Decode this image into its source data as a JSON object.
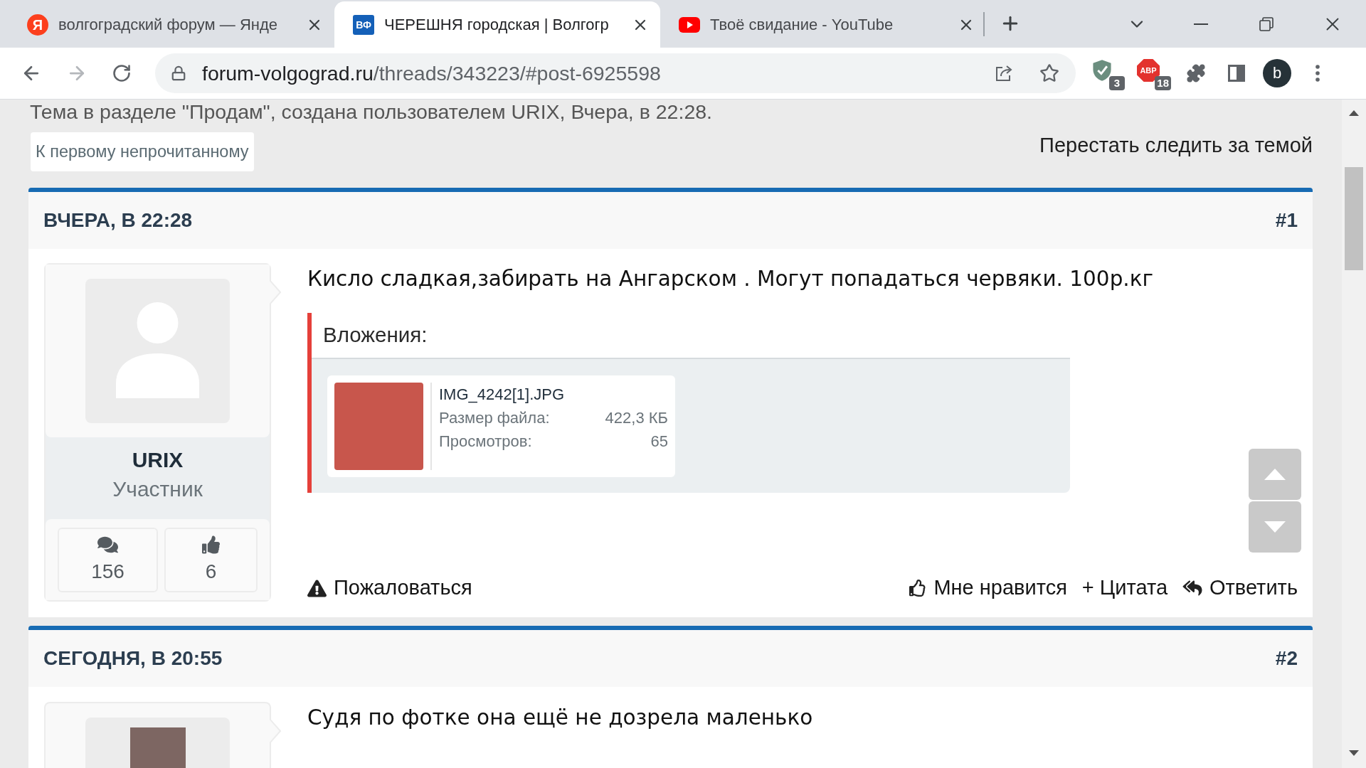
{
  "browser": {
    "tabs": [
      {
        "kind": "letter-circle",
        "favicon": "Я",
        "title": "волгоградский форум — Янде",
        "selected": false
      },
      {
        "kind": "letter-square",
        "favicon": "ВФ",
        "title": "ЧЕРЕШНЯ городская | Волгогр",
        "selected": true
      },
      {
        "kind": "play",
        "title": "Твоё свидание - YouTube",
        "selected": false
      }
    ],
    "address_bar": {
      "host": "forum-volgograd.ru",
      "path": "/threads/343223/#post-6925598"
    },
    "extensions": [
      {
        "kind": "shield",
        "badge": "3"
      },
      {
        "kind": "octagon",
        "label": "ABP",
        "badge": "18"
      }
    ],
    "profile": "b"
  },
  "thread": {
    "info": "Тема в разделе \"Продам\", создана пользователем URIX, Вчера, в 22:28.",
    "first_unread_button": "К первому непрочитанному",
    "unwatch_link": "Перестать следить за темой"
  },
  "posts": [
    {
      "date": "ВЧЕРА, В 22:28",
      "number": "#1",
      "author": {
        "avatar": {
          "kind": "placeholder"
        },
        "name": "URIX",
        "role": "Участник",
        "stats": [
          {
            "kind": "messages",
            "value": "156"
          },
          {
            "kind": "likes",
            "value": "6"
          }
        ]
      },
      "message": "Кисло сладкая,забирать на Ангарском . Могут попадаться червяки. 100р.кг",
      "attachments": {
        "title": "Вложения:",
        "files": [
          {
            "name": "IMG_4242[1].JPG",
            "rows": [
              {
                "label": "Размер файла:",
                "value": "422,3 КБ"
              },
              {
                "label": "Просмотров:",
                "value": "65"
              }
            ]
          }
        ]
      },
      "actions": {
        "report": "Пожаловаться",
        "like": "Мне нравится",
        "quote": "+ Цитата",
        "reply": "Ответить"
      }
    },
    {
      "date": "СЕГОДНЯ, В 20:55",
      "number": "#2",
      "author": {
        "avatar": {
          "kind": "photo"
        }
      },
      "message": "Судя по фотке она ещё не дозрела маленько"
    }
  ]
}
